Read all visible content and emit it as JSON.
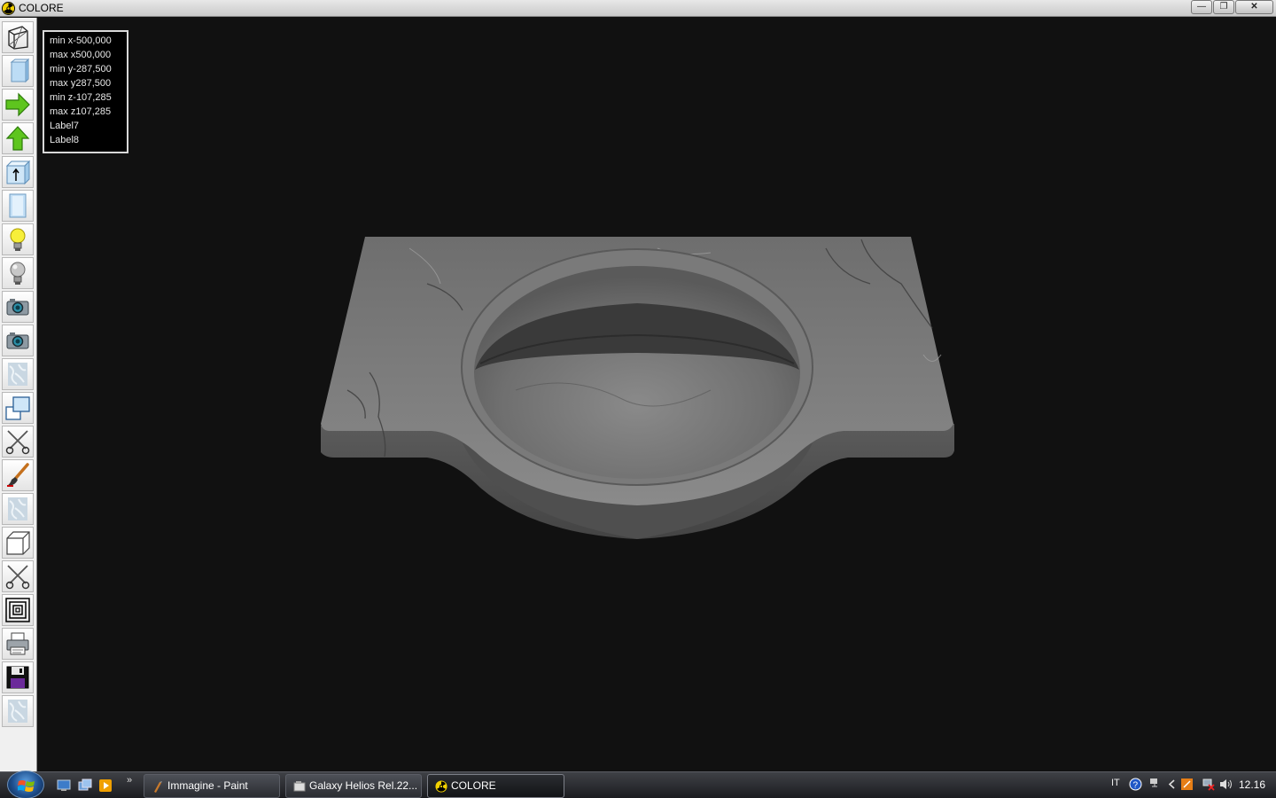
{
  "window": {
    "title": "COLORE",
    "buttons": {
      "minimize": "—",
      "maximize": "❐",
      "close": "✕"
    }
  },
  "toolbar": {
    "tools": [
      {
        "name": "wireframe-view-icon"
      },
      {
        "name": "solid-view-icon"
      },
      {
        "name": "arrow-right-icon"
      },
      {
        "name": "arrow-up-icon"
      },
      {
        "name": "box-up-icon"
      },
      {
        "name": "front-panel-icon"
      },
      {
        "name": "light-on-icon"
      },
      {
        "name": "light-off-icon"
      },
      {
        "name": "camera-icon"
      },
      {
        "name": "camera-2-icon"
      },
      {
        "name": "texture-icon"
      },
      {
        "name": "window-frame-icon"
      },
      {
        "name": "scissors-icon"
      },
      {
        "name": "paint-brush-icon"
      },
      {
        "name": "texture-2-icon"
      },
      {
        "name": "cube-icon"
      },
      {
        "name": "scissors-2-icon"
      },
      {
        "name": "concentric-squares-icon"
      },
      {
        "name": "printer-icon"
      },
      {
        "name": "floppy-disk-icon"
      },
      {
        "name": "texture-3-icon"
      }
    ]
  },
  "info": {
    "lines": [
      "min x-500,000",
      "max x500,000",
      "min y-287,500",
      "max y287,500",
      "min z-107,285",
      "max z107,285",
      "Label7",
      "Label8"
    ]
  },
  "taskbar": {
    "tasks": [
      {
        "label": "Immagine - Paint"
      },
      {
        "label": "Galaxy Helios  Rel.22..."
      },
      {
        "label": "COLORE"
      }
    ],
    "tray": {
      "language": "IT",
      "time": "12.16"
    }
  }
}
